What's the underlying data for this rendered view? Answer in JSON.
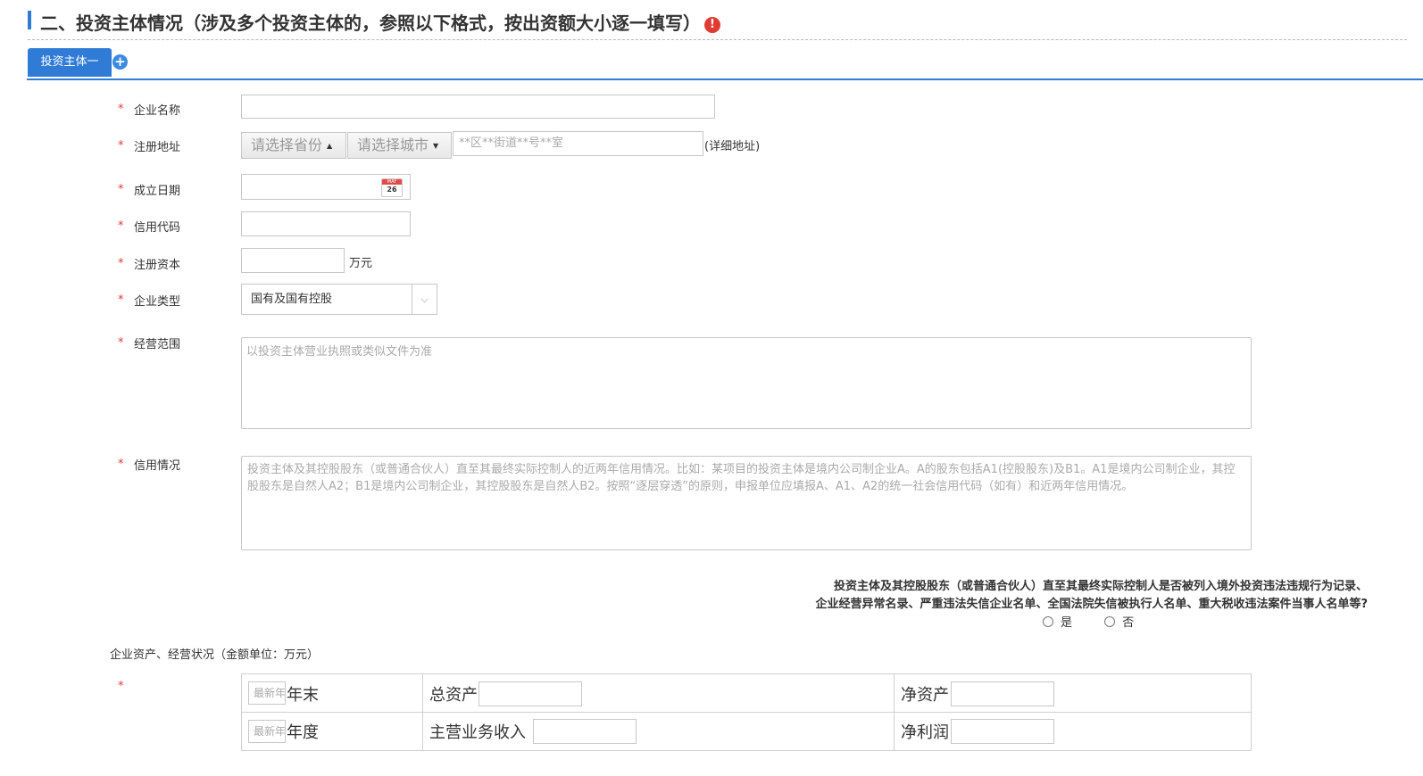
{
  "section": {
    "title": "二、投资主体情况（涉及多个投资主体的，参照以下格式，按出资额大小逐一填写）",
    "warning_icon": "exclamation-circle-icon",
    "warning_glyph": "!"
  },
  "tabs": {
    "items": [
      {
        "label": "投资主体一"
      }
    ],
    "add_glyph": "+"
  },
  "form": {
    "required_mark": "*",
    "company_name": {
      "label": "企业名称",
      "value": ""
    },
    "reg_address": {
      "label": "注册地址",
      "province_placeholder": "请选择省份",
      "city_placeholder": "请选择城市",
      "detail_placeholder": "**区**街道**号**室",
      "detail_suffix": "(详细地址)"
    },
    "establish_date": {
      "label": "成立日期",
      "value": "",
      "calendar_icon": "calendar-icon",
      "calendar_month": "MAY",
      "calendar_day": "26"
    },
    "credit_code": {
      "label": "信用代码",
      "value": ""
    },
    "reg_capital": {
      "label": "注册资本",
      "value": "",
      "unit": "万元"
    },
    "company_type": {
      "label": "企业类型",
      "value": "国有及国有控股",
      "arrow": "⌵"
    },
    "business_scope": {
      "label": "经营范围",
      "placeholder": "以投资主体营业执照或类似文件为准"
    },
    "credit_status": {
      "label": "信用情况",
      "placeholder": "投资主体及其控股股东（或普通合伙人）直至其最终实际控制人的近两年信用情况。比如：某项目的投资主体是境内公司制企业A。A的股东包括A1(控股股东)及B1。A1是境内公司制企业，其控股股东是自然人A2；B1是境内公司制企业，其控股股东是自然人B2。按照“逐层穿透”的原则，申报单位应填报A、A1、A2的统一社会信用代码（如有）和近两年信用情况。"
    }
  },
  "question": {
    "line1": "投资主体及其控股股东（或普通合伙人）直至其最终实际控制人是否被列入境外投资违法违规行为记录、",
    "line2": "企业经营异常名录、严重违法失信企业名单、全国法院失信被执行人名单、重大税收违法案件当事人名单等?",
    "yes": "是",
    "no": "否"
  },
  "financial": {
    "heading": "企业资产、经营状况（金额单位：万元）",
    "rows": [
      {
        "year_placeholder": "最新年",
        "year_suffix": "年末",
        "col1_label": "总资产",
        "col2_label": "净资产"
      },
      {
        "year_placeholder": "最新年",
        "year_suffix": "年度",
        "col1_label": "主营业务收入",
        "col2_label": "净利润"
      }
    ]
  },
  "colors": {
    "accent": "#2f7bd6",
    "required": "#e03c31",
    "warning": "#e03c31"
  }
}
